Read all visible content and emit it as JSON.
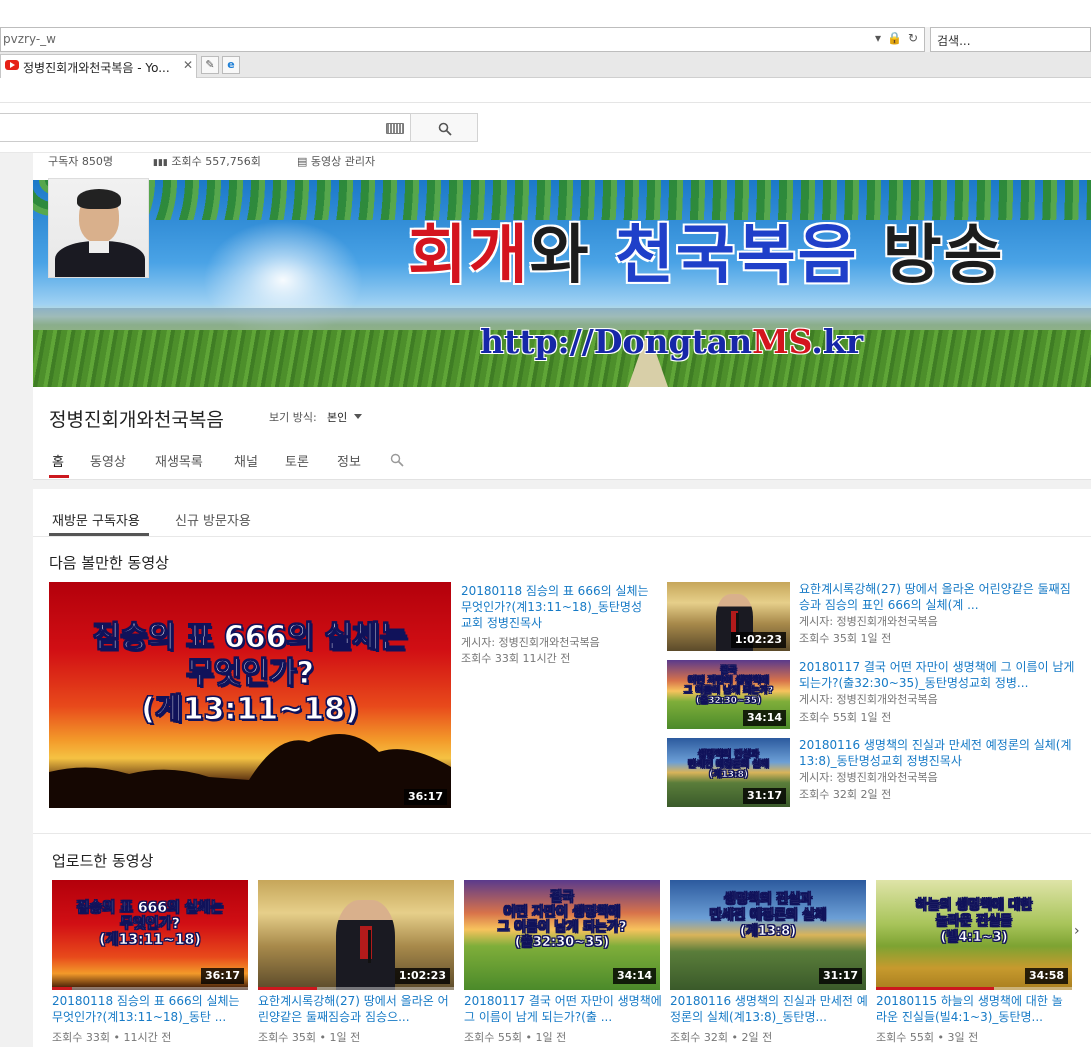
{
  "browser": {
    "address": "pvzry-_w",
    "search_placeholder": "검색...",
    "tab_title": "정병진회개와천국복음 - Yo...",
    "tab_close": "✕"
  },
  "channel": {
    "subscribers": "구독자 850명",
    "views": "조회수 557,756회",
    "manager": "동영상 관리자",
    "name": "정병진회개와천국복음",
    "view_as_label": "보기 방식:",
    "view_as_value": "본인",
    "banner_title": {
      "p1": "회개",
      "p2": "와 ",
      "p3": "천국복음",
      "p4": " 방송"
    },
    "banner_url": {
      "p1": "http://Dongtan",
      "p2": "MS",
      "p3": ".kr"
    }
  },
  "nav_tabs": [
    "홈",
    "동영상",
    "재생목록",
    "채널",
    "토론",
    "정보"
  ],
  "sub_tabs": [
    "재방문 구독자용",
    "신규 방문자용"
  ],
  "sections": {
    "watch_next": "다음 볼만한 동영상",
    "uploads": "업로드한 동영상"
  },
  "featured": {
    "thumb_text": [
      "짐승의 표 666의 실체는",
      "무엇인가?",
      "(계13:11~18)"
    ],
    "duration": "36:17",
    "title": "20180118 짐승의 표 666의 실체는 무엇인가?(계13:11~18)_동탄명성교회 정병진목사",
    "poster": "게시자: 정병진회개와천국복음",
    "meta": "조회수 33회   11시간 전"
  },
  "side_videos": [
    {
      "title": "요한계시록강해(27) 땅에서 올라온 어린양같은 둘째짐승과 짐승의 표인 666의 실체(계 ...",
      "poster": "게시자: 정병진회개와천국복음",
      "meta": "조회수 35회   1일 전",
      "duration": "1:02:23",
      "thumb_text": []
    },
    {
      "title": "20180117 결국 어떤 자만이 생명책에 그 이름이 남게 되는가?(출32:30~35)_동탄명성교회 정병...",
      "poster": "게시자: 정병진회개와천국복음",
      "meta": "조회수 55회   1일 전",
      "duration": "34:14",
      "thumb_text": [
        "결국",
        "어떤 자만이 생명책에",
        "그 이름이 남게 되는가?",
        "(출32:30~35)"
      ]
    },
    {
      "title": "20180116 생명책의 진실과 만세전 예정론의 실체(계13:8)_동탄명성교회 정병진목사",
      "poster": "게시자: 정병진회개와천국복음",
      "meta": "조회수 32회   2일 전",
      "duration": "31:17",
      "thumb_text": [
        "생명책의 진실과",
        "만세전 예정론의 실체",
        "(계13:8)"
      ]
    }
  ],
  "uploads": [
    {
      "title": "20180118 짐승의 표 666의 실체는 무엇인가?(계13:11~18)_동탄 ...",
      "meta": "조회수 33회 • 11시간 전",
      "duration": "36:17",
      "thumb_text": [
        "짐승의 표 666의 실체는",
        "무엇인가?",
        "(계13:11~18)"
      ],
      "watched_pct": 10
    },
    {
      "title": "요한계시록강해(27) 땅에서 올라온 어린양같은 둘째짐승과 짐승으...",
      "meta": "조회수 35회 • 1일 전",
      "duration": "1:02:23",
      "thumb_text": [],
      "watched_pct": 30
    },
    {
      "title": "20180117 결국 어떤 자만이 생명책에 그 이름이 남게 되는가?(출 ...",
      "meta": "조회수 55회 • 1일 전",
      "duration": "34:14",
      "thumb_text": [
        "결국",
        "어떤 자만이 생명책에",
        "그 이름이 남게 되는가?",
        "(출32:30~35)"
      ],
      "watched_pct": 0
    },
    {
      "title": "20180116 생명책의 진실과 만세전 예정론의 실체(계13:8)_동탄명...",
      "meta": "조회수 32회 • 2일 전",
      "duration": "31:17",
      "thumb_text": [
        "생명책의 진실과",
        "만세전 예정론의 실체",
        "(계13:8)"
      ],
      "watched_pct": 0
    },
    {
      "title": "20180115 하늘의 생명책에 대한 놀라운 진실들(빌4:1~3)_동탄명...",
      "meta": "조회수 55회 • 3일 전",
      "duration": "34:58",
      "thumb_text": [
        "하늘의 생명책에 대한",
        "놀라운 진실들",
        "(빌4:1~3)"
      ],
      "watched_pct": 60
    }
  ]
}
